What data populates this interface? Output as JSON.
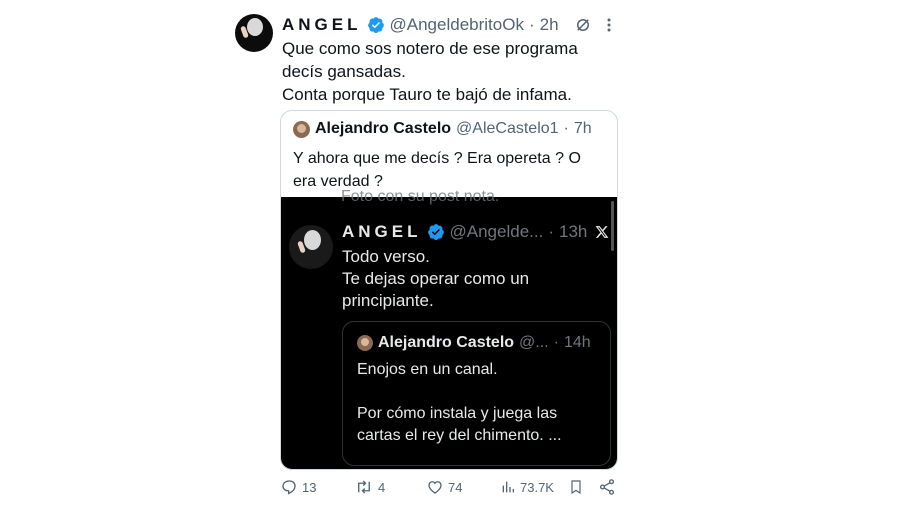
{
  "tweet": {
    "author_name": "ANGEL",
    "handle": "@AngeldebritoOk",
    "dot": "·",
    "time": "2h",
    "text_lines": [
      "Que como sos notero de ese programa",
      "decís gansadas.",
      "Conta porque Tauro te bajó de infama."
    ]
  },
  "quote": {
    "author_name": "Alejandro Castelo",
    "handle": "@AleCastelo1",
    "dot": "·",
    "time": "7h",
    "text_lines": [
      "Y ahora que me decís ? Era opereta ? O",
      "era verdad ?"
    ]
  },
  "screenshot": {
    "cut_text": "Foto con su post nota.",
    "author_name": "ANGEL",
    "handle": "@Angelde...",
    "dot": "·",
    "time": "13h",
    "text_lines": [
      "Todo verso.",
      "Te dejas operar como un",
      "principiante."
    ],
    "inner_quote": {
      "author_name": "Alejandro Castelo",
      "handle": "@...",
      "dot": "·",
      "time": "14h",
      "text_lines": [
        "Enojos en un canal.",
        "",
        "Por cómo instala y juega las",
        "cartas el rey del chimento. ..."
      ]
    }
  },
  "actions": {
    "replies": "13",
    "reposts": "4",
    "likes": "74",
    "views": "73.7K"
  },
  "colors": {
    "verified": "#1d9bf0",
    "text": "#0f1419",
    "muted": "#536471",
    "dark_bg": "#000000"
  }
}
